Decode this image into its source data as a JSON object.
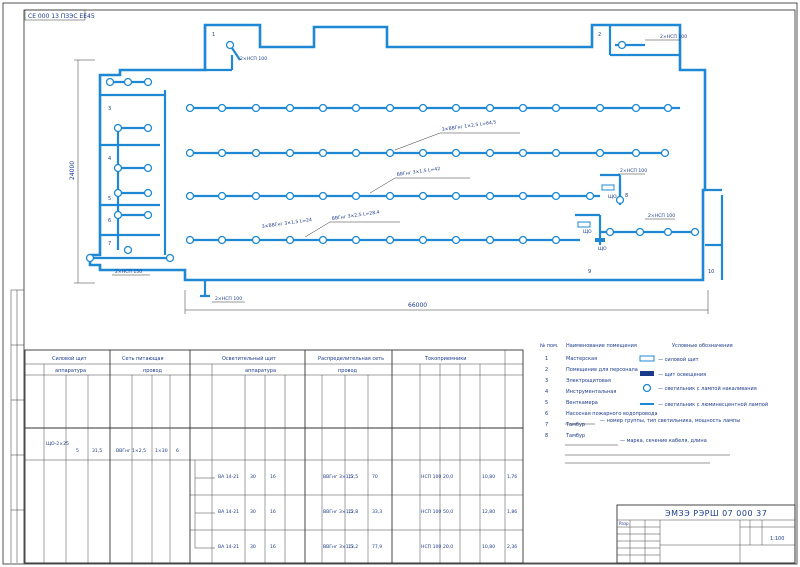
{
  "sheet": {
    "corner_label": "СЕ 000 13 ПЗЭС ЕЕ45",
    "code": "ЭМЗЭ РЭРШ 07 000 37",
    "stamp_row1": "Разр.",
    "stamp_sheet": "1:100"
  },
  "plan": {
    "dim_length": "66000",
    "dim_width": "24000",
    "room_numbers": [
      "1",
      "2",
      "3",
      "4",
      "5",
      "6",
      "7",
      "8",
      "9",
      "10"
    ],
    "cable_labels": [
      "3×ВВГнг 1×2,5 L=64,5",
      "ВВГнг 3×1,5 L=42",
      "ВВГнг 3×2,5 L=28,4",
      "3×ВВГнг 3×1,5 L=24"
    ],
    "lamp_labels": [
      "2×НСП 100",
      "2×НСП 100",
      "2×НСП 100",
      "2×НСП 150",
      "2×НСП 100",
      "2×НСП 100"
    ],
    "panel_labels": [
      "ЩО",
      "ЩО",
      "ЩО"
    ]
  },
  "table": {
    "headers": [
      "Силовой щит",
      "Сеть питающая",
      "Осветительный щит",
      "Распределительная сеть",
      "Токоприемники"
    ],
    "sub_headers": [
      "аппаратура",
      "провод",
      "аппаратура",
      "провод"
    ],
    "rows": [
      {
        "panel": "ЩО-2×25",
        "value1": "5",
        "value2": "31,5",
        "cable": "ВВГнг 1×2,5",
        "length": "1×30",
        "count": "6"
      },
      {
        "panel": "ВА 14-21",
        "value1": "30",
        "value2": "16",
        "cable": "ВВГнг 3×1,5",
        "length": "12,5",
        "count": "70",
        "lamp": "НСП 100",
        "power": "20,0"
      },
      {
        "panel": "ВА 14-21",
        "value1": "30",
        "value2": "16",
        "cable": "ВВГнг 3×1,5",
        "length": "12,8",
        "count": "33,3",
        "lamp": "НСП 100",
        "power": "50,0"
      },
      {
        "panel": "ВА 14-21",
        "value1": "30",
        "value2": "16",
        "cable": "ВВГнг 3×1,5",
        "length": "13,2",
        "count": "77,9",
        "lamp": "НСП 100",
        "power": "20,0"
      }
    ],
    "totals": [
      "10,80",
      "12,80",
      "10,80"
    ],
    "right_values": [
      "1,76",
      "1,86",
      "2,36"
    ]
  },
  "legend": {
    "column_headers": [
      "№ пом.",
      "Наименование помещения"
    ],
    "rooms": [
      "Мастерская",
      "Помещение для персонала",
      "Электрощитовая",
      "Инструментальная",
      "Венткамера",
      "Насосная пожарного водопровода",
      "Тамбур",
      "Тамбур"
    ],
    "room_numbers": [
      "1",
      "2",
      "3",
      "4",
      "5",
      "6",
      "7",
      "8"
    ],
    "title": "Условные обозначения",
    "items": [
      "— силовой щит",
      "— щит освещения",
      "— светильник с лампой накаливания",
      "— светильник с люминесцентной лампой"
    ],
    "formula_note": "— номер группы, тип светильника, мощность лампы",
    "cable_note": "— марка, сечение кабеля, длина"
  }
}
